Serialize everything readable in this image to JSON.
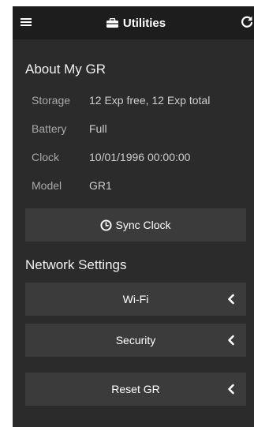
{
  "navbar": {
    "title": "Utilities",
    "menu_icon": "hamburger-icon",
    "title_icon": "toolbox-icon",
    "refresh_icon": "refresh-icon"
  },
  "about": {
    "title": "About My GR",
    "rows": [
      {
        "label": "Storage",
        "value": "12 Exp free, 12 Exp total"
      },
      {
        "label": "Battery",
        "value": "Full"
      },
      {
        "label": "Clock",
        "value": "10/01/1996 00:00:00"
      },
      {
        "label": "Model",
        "value": "GR1"
      }
    ],
    "sync_button": "Sync Clock",
    "sync_icon": "clock-icon"
  },
  "network": {
    "title": "Network Settings",
    "items": [
      {
        "label": "Wi-Fi"
      },
      {
        "label": "Security"
      }
    ]
  },
  "reset": {
    "label": "Reset GR"
  },
  "colors": {
    "background": "#2b2b2b",
    "navbar": "#1d1d1d",
    "button": "#3b3b3b",
    "text": "#ffffff",
    "muted_text": "#a9a9a9"
  }
}
